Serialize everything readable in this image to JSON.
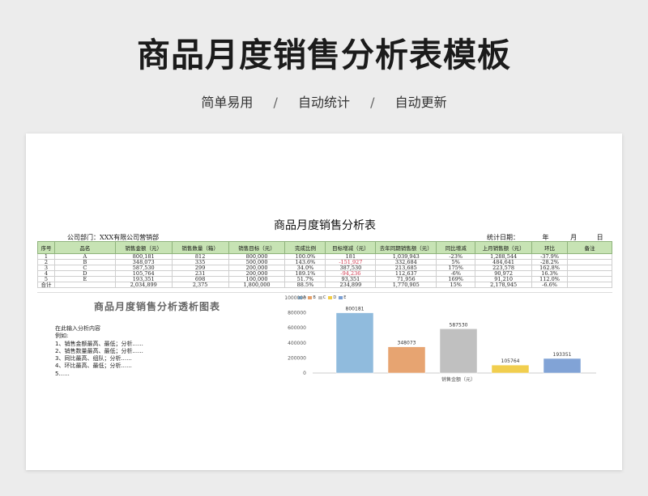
{
  "hero": {
    "title": "商品月度销售分析表模板",
    "features": [
      "简单易用",
      "自动统计",
      "自动更新"
    ],
    "separator": "/"
  },
  "sheet": {
    "title": "商品月度销售分析表",
    "department_label": "公司部门：",
    "department_value": "XXX有限公司营销部",
    "date_label": "统计日期：",
    "year_label": "年",
    "month_label": "月",
    "day_label": "日",
    "headers": [
      "序号",
      "品名",
      "销售金额（元）",
      "销售数量（箱）",
      "销售目标（元）",
      "完成比例",
      "目标增减（元）",
      "去年同期销售额（元）",
      "同比增减",
      "上月销售额（元）",
      "环比",
      "备注"
    ],
    "rows": [
      [
        "1",
        "A",
        "800,181",
        "812",
        "800,000",
        "100.0%",
        "181",
        "1,039,943",
        "-23%",
        "1,288,544",
        "-37.9%",
        ""
      ],
      [
        "2",
        "B",
        "348,073",
        "335",
        "500,000",
        "143.6%",
        "-151,927",
        "332,684",
        "5%",
        "484,641",
        "-28.2%",
        ""
      ],
      [
        "3",
        "C",
        "587,530",
        "299",
        "200,000",
        "34.0%",
        "387,530",
        "213,685",
        "175%",
        "223,578",
        "162.8%",
        ""
      ],
      [
        "4",
        "D",
        "105,764",
        "231",
        "200,000",
        "189.1%",
        "-94,236",
        "112,637",
        "-6%",
        "90,972",
        "16.3%",
        ""
      ],
      [
        "5",
        "E",
        "193,351",
        "698",
        "100,000",
        "51.7%",
        "93,351",
        "71,956",
        "169%",
        "91,210",
        "112.0%",
        ""
      ],
      [
        "合计",
        "",
        "2,034,899",
        "2,375",
        "1,800,000",
        "88.5%",
        "234,899",
        "1,770,905",
        "15%",
        "2,178,945",
        "-6.6%",
        ""
      ]
    ]
  },
  "pivot": {
    "title": "商品月度销售分析透析图表",
    "analysis_lines": [
      "在此输入分析内容",
      "例如:",
      "1、销售金额最高、最低；分析......",
      "2、销售数量最高、最低；分析......",
      "3、同比最高、组队；分析......",
      "4、环比最高、最低；分析......",
      "5......"
    ]
  },
  "chart_data": {
    "type": "bar",
    "categories": [
      "A",
      "B",
      "C",
      "D",
      "E"
    ],
    "values": [
      800181,
      348073,
      587530,
      105764,
      193351
    ],
    "colors": [
      "#8bb8dc",
      "#e6a06a",
      "#bdbdbd",
      "#f1cc45",
      "#7b9fd4"
    ],
    "xlabel": "销售金额（元）",
    "ylabel": "",
    "ylim": [
      0,
      1000000
    ],
    "yticks": [
      "0",
      "200000",
      "400000",
      "600000",
      "800000",
      "1000000"
    ],
    "legend_position": "top",
    "grid": false
  }
}
